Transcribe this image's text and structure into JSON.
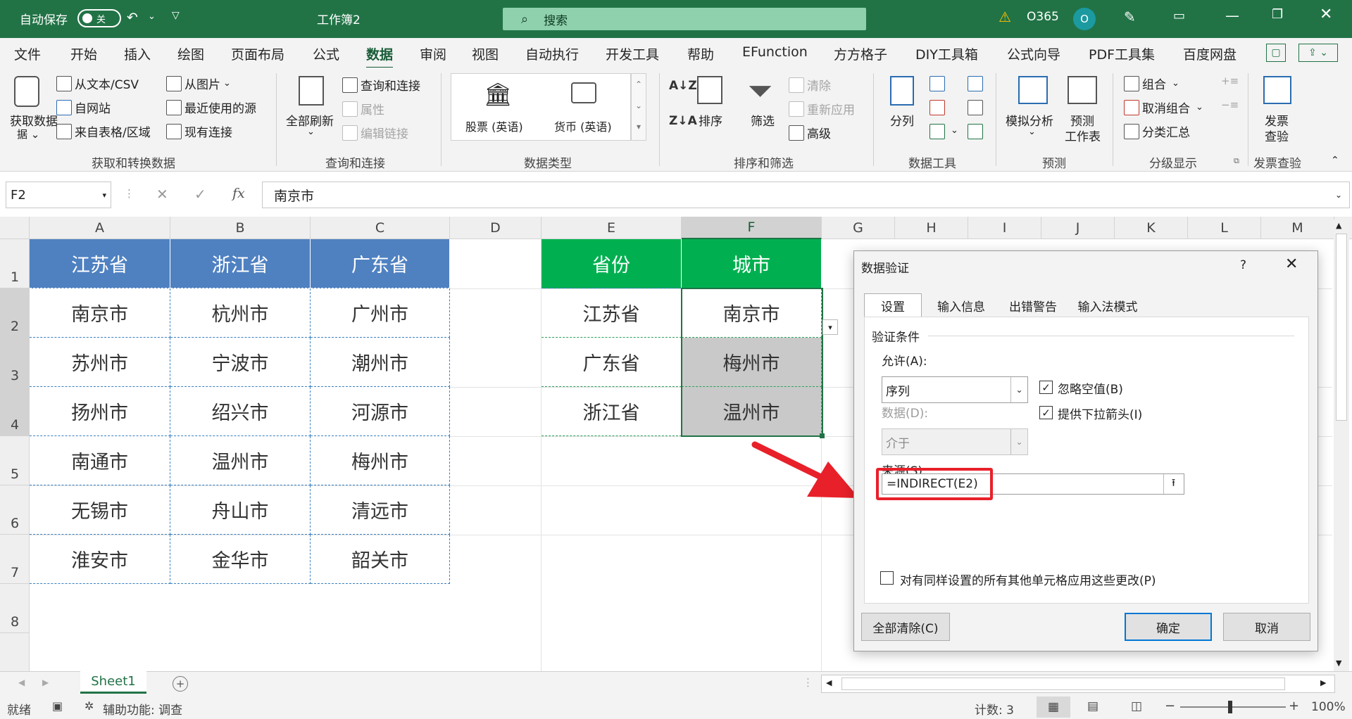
{
  "titlebar": {
    "autosave": "自动保存",
    "toggle": "关",
    "workbook": "工作簿2",
    "search_placeholder": "搜索",
    "account": "O365",
    "avatar": "O"
  },
  "tabs": [
    "文件",
    "开始",
    "插入",
    "绘图",
    "页面布局",
    "公式",
    "数据",
    "审阅",
    "视图",
    "自动执行",
    "开发工具",
    "帮助",
    "EFunction",
    "方方格子",
    "DIY工具箱",
    "公式向导",
    "PDF工具集",
    "百度网盘"
  ],
  "ribbon": {
    "get_data": "获取数据",
    "from_text": "从文本/CSV",
    "from_web": "自网站",
    "from_table": "来自表格/区域",
    "from_picture": "从图片",
    "recent_sources": "最近使用的源",
    "existing_conn": "现有连接",
    "refresh_all": "全部刷新",
    "queries_conn": "查询和连接",
    "properties": "属性",
    "edit_links": "编辑链接",
    "stocks": "股票 (英语)",
    "currency": "货币 (英语)",
    "sort": "排序",
    "filter": "筛选",
    "clear": "清除",
    "reapply": "重新应用",
    "advanced": "高级",
    "split": "分列",
    "whatif": "模拟分析",
    "forecast": "预测",
    "forecast_sheet": "工作表",
    "group": "组合",
    "ungroup": "取消组合",
    "subtotal": "分类汇总",
    "invoice": "发票",
    "invoice2": "查验",
    "groups": {
      "g1": "获取和转换数据",
      "g2": "查询和连接",
      "g3": "数据类型",
      "g4": "排序和筛选",
      "g5": "数据工具",
      "g6": "预测",
      "g7": "分级显示",
      "g8": "发票查验"
    }
  },
  "formula_bar": {
    "name_box": "F2",
    "fx": "fx",
    "content": "南京市"
  },
  "columns": [
    "A",
    "B",
    "C",
    "D",
    "E",
    "F",
    "G",
    "H",
    "I",
    "J",
    "K",
    "L",
    "M"
  ],
  "rows": [
    "1",
    "2",
    "3",
    "4",
    "5",
    "6",
    "7",
    "8"
  ],
  "table1": {
    "headers": [
      "江苏省",
      "浙江省",
      "广东省"
    ],
    "rows": [
      [
        "南京市",
        "杭州市",
        "广州市"
      ],
      [
        "苏州市",
        "宁波市",
        "潮州市"
      ],
      [
        "扬州市",
        "绍兴市",
        "河源市"
      ],
      [
        "南通市",
        "温州市",
        "梅州市"
      ],
      [
        "无锡市",
        "舟山市",
        "清远市"
      ],
      [
        "淮安市",
        "金华市",
        "韶关市"
      ]
    ]
  },
  "table2": {
    "headers": [
      "省份",
      "城市"
    ],
    "rows": [
      [
        "江苏省",
        "南京市"
      ],
      [
        "广东省",
        "梅州市"
      ],
      [
        "浙江省",
        "温州市"
      ]
    ]
  },
  "dialog": {
    "title": "数据验证",
    "help": "?",
    "tabs": [
      "设置",
      "输入信息",
      "出错警告",
      "输入法模式"
    ],
    "criteria": "验证条件",
    "allow_label": "允许(A):",
    "allow_value": "序列",
    "ignore_blank": "忽略空值(B)",
    "dropdown": "提供下拉箭头(I)",
    "data_label": "数据(D):",
    "data_value": "介于",
    "source_label": "来源(S):",
    "source_value": "=INDIRECT(E2)",
    "apply_all": "对有同样设置的所有其他单元格应用这些更改(P)",
    "clear_all": "全部清除(C)",
    "ok": "确定",
    "cancel": "取消"
  },
  "sheet_tab": "Sheet1",
  "status": {
    "ready": "就绪",
    "accessibility": "辅助功能: 调查",
    "count": "计数: 3",
    "zoom": "100%"
  },
  "colors": {
    "excel_green": "#217346",
    "header_blue": "#4f81c1",
    "header_green": "#00b050",
    "highlight_red": "#e8202a"
  }
}
